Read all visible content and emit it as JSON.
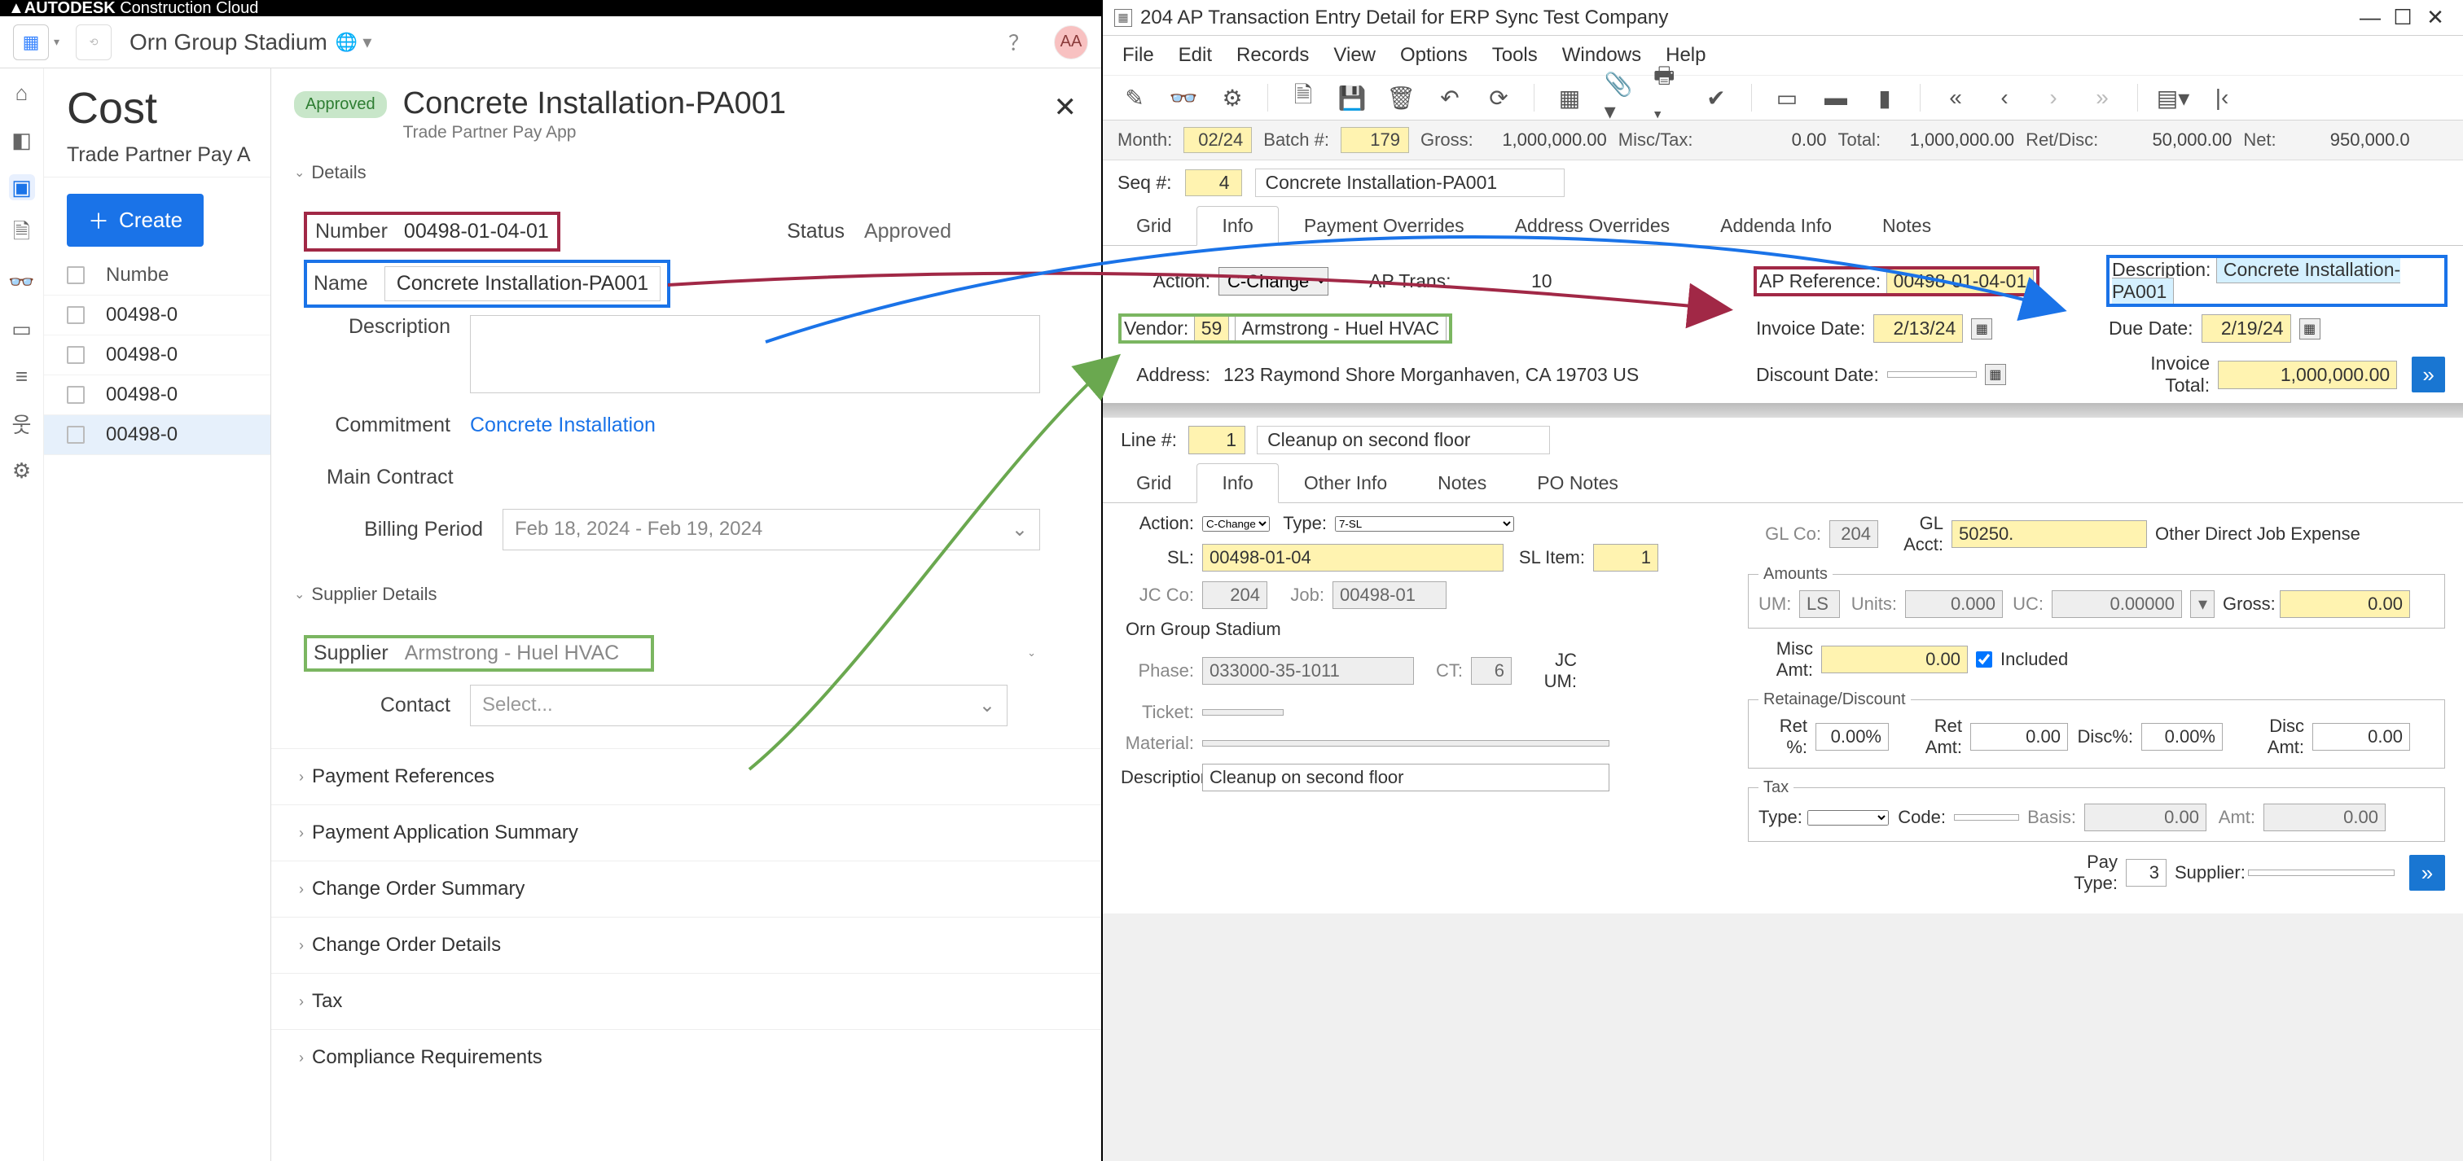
{
  "acc": {
    "suite_brand_bold": "AUTODESK",
    "suite_brand_light": "Construction Cloud",
    "project_name": "Orn Group Stadium",
    "avatar_initials": "AA",
    "module_title": "Cost",
    "sub_tab": "Trade Partner Pay A",
    "create_label": "Create",
    "table_header_number": "Numbe",
    "rows": [
      "00498-0",
      "00498-0",
      "00498-0",
      "00498-0"
    ],
    "detail": {
      "badge": "Approved",
      "title": "Concrete Installation-PA001",
      "subtitle": "Trade Partner Pay App",
      "section_details": "Details",
      "section_supplier": "Supplier Details",
      "labels": {
        "number": "Number",
        "status": "Status",
        "name": "Name",
        "description": "Description",
        "commitment": "Commitment",
        "main_contract": "Main Contract",
        "billing_period": "Billing Period",
        "supplier": "Supplier",
        "contact": "Contact"
      },
      "values": {
        "number": "00498-01-04-01",
        "status": "Approved",
        "name": "Concrete Installation-PA001",
        "commitment": "Concrete Installation",
        "billing_period": "Feb 18, 2024 - Feb 19, 2024",
        "supplier": "Armstrong - Huel HVAC",
        "contact": "Select..."
      },
      "collapsed_sections": [
        "Payment References",
        "Payment Application Summary",
        "Change Order Summary",
        "Change Order Details",
        "Tax",
        "Compliance Requirements"
      ]
    }
  },
  "erp": {
    "window_title": "204 AP Transaction Entry Detail for ERP Sync Test Company",
    "menus": [
      "File",
      "Edit",
      "Records",
      "View",
      "Options",
      "Tools",
      "Windows",
      "Help"
    ],
    "header": {
      "month_lbl": "Month:",
      "month": "02/24",
      "batch_lbl": "Batch #:",
      "batch": "179",
      "gross_lbl": "Gross:",
      "gross": "1,000,000.00",
      "misc_lbl": "Misc/Tax:",
      "misc": "0.00",
      "total_lbl": "Total:",
      "total": "1,000,000.00",
      "ret_lbl": "Ret/Disc:",
      "ret": "50,000.00",
      "net_lbl": "Net:",
      "net": "950,000.0"
    },
    "seq": {
      "lbl": "Seq #:",
      "val": "4",
      "desc": "Concrete Installation-PA001"
    },
    "tabs_upper": [
      "Grid",
      "Info",
      "Payment Overrides",
      "Address Overrides",
      "Addenda Info",
      "Notes"
    ],
    "upper": {
      "action_lbl": "Action:",
      "action": "C-Change",
      "aptrans_lbl": "AP Trans:",
      "aptrans": "10",
      "apref_lbl": "AP Reference:",
      "apref": "00498-01-04-01",
      "desc_lbl": "Description:",
      "desc": "Concrete Installation-PA001",
      "vendor_lbl": "Vendor:",
      "vendor_no": "59",
      "vendor_name": "Armstrong - Huel HVAC",
      "invdate_lbl": "Invoice Date:",
      "invdate": "2/13/24",
      "duedate_lbl": "Due Date:",
      "duedate": "2/19/24",
      "address_lbl": "Address:",
      "address": "123 Raymond Shore  Morganhaven, CA  19703  US",
      "discdate_lbl": "Discount Date:",
      "invtotal_lbl": "Invoice Total:",
      "invtotal": "1,000,000.00"
    },
    "line": {
      "lbl": "Line #:",
      "val": "1",
      "desc": "Cleanup on second floor"
    },
    "tabs_lower": [
      "Grid",
      "Info",
      "Other Info",
      "Notes",
      "PO Notes"
    ],
    "lower": {
      "action_lbl": "Action:",
      "action": "C-Change",
      "type_lbl": "Type:",
      "type": "7-SL",
      "glco_lbl": "GL Co:",
      "glco": "204",
      "glacct_lbl": "GL Acct:",
      "glacct": "50250.",
      "glacct_desc": "Other Direct Job Expense",
      "sl_lbl": "SL:",
      "sl": "00498-01-04",
      "slitem_lbl": "SL Item:",
      "slitem": "1",
      "jcco_lbl": "JC Co:",
      "jcco": "204",
      "job_lbl": "Job:",
      "job": "00498-01",
      "project": "Orn Group Stadium",
      "phase_lbl": "Phase:",
      "phase": "033000-35-1011",
      "ct_lbl": "CT:",
      "ct": "6",
      "jcum_lbl": "JC UM:",
      "ticket_lbl": "Ticket:",
      "material_lbl": "Material:",
      "desc_lbl": "Description:",
      "desc": "Cleanup on second floor",
      "amounts_legend": "Amounts",
      "um_lbl": "UM:",
      "um": "LS",
      "units_lbl": "Units:",
      "units": "0.000",
      "uc_lbl": "UC:",
      "uc": "0.00000",
      "gross_lbl": "Gross:",
      "gross": "0.00",
      "miscamt_lbl": "Misc Amt:",
      "miscamt": "0.00",
      "included_lbl": "Included",
      "retlegend": "Retainage/Discount",
      "retpct_lbl": "Ret %:",
      "retpct": "0.00%",
      "retamt_lbl": "Ret Amt:",
      "retamt": "0.00",
      "discpct_lbl": "Disc%:",
      "discpct": "0.00%",
      "discamt_lbl": "Disc Amt:",
      "discamt": "0.00",
      "taxlegend": "Tax",
      "taxtype_lbl": "Type:",
      "taxcode_lbl": "Code:",
      "basis_lbl": "Basis:",
      "basis": "0.00",
      "amt_lbl": "Amt:",
      "amt": "0.00",
      "paytype_lbl": "Pay Type:",
      "paytype": "3",
      "supplier_lbl": "Supplier:"
    }
  }
}
